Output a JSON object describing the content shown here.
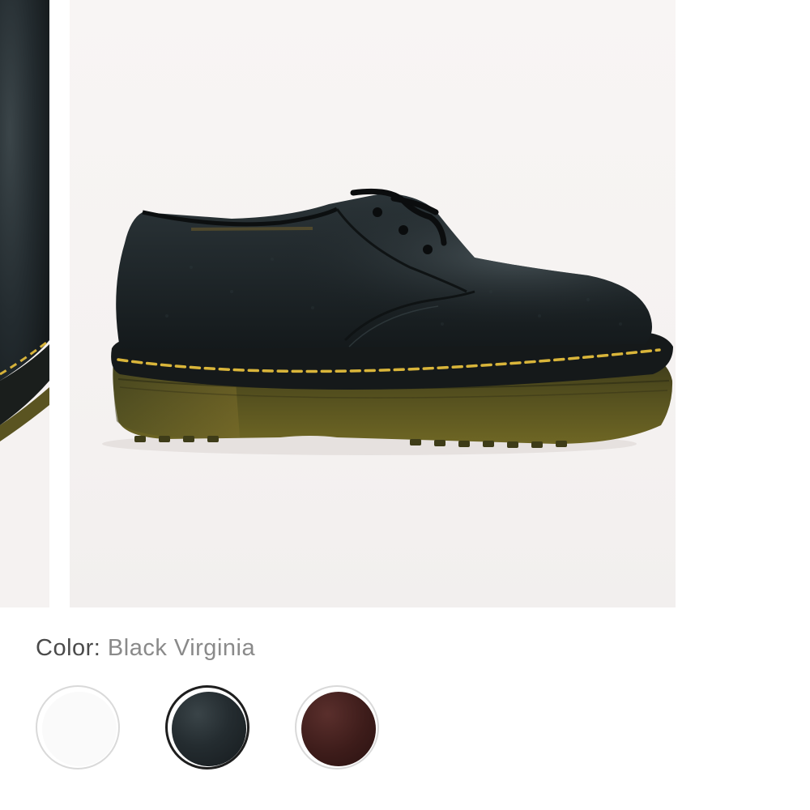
{
  "product": {
    "images": [
      {
        "name": "previous-image",
        "alt": "shoe detail"
      },
      {
        "name": "current-image",
        "alt": "shoe side view"
      }
    ]
  },
  "color_selector": {
    "label": "Color:",
    "selected_value": "Black Virginia",
    "swatches": [
      {
        "name": "white",
        "color": "#fafafa",
        "selected": false
      },
      {
        "name": "black",
        "color": "#1e2428",
        "selected": true
      },
      {
        "name": "brown",
        "color": "#3d1c1a",
        "selected": false
      }
    ]
  },
  "colors": {
    "leather": "#1d2427",
    "stitching": "#d9b53a",
    "sole": "#4a4a1e",
    "background": "#f6f3f2"
  }
}
